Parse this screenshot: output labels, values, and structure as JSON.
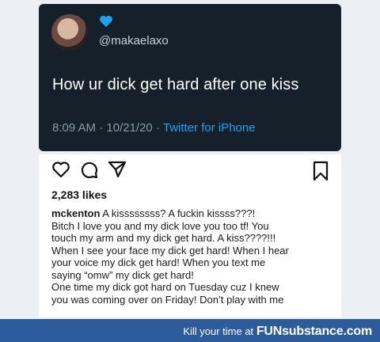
{
  "tweet": {
    "handle": "@makaelaxo",
    "text": "How ur dick get hard after one kiss",
    "time": "8:09 AM",
    "date": "10/21/20",
    "source": "Twitter for iPhone",
    "heart_color": "#1da1f2"
  },
  "post": {
    "likes": "2,283 likes",
    "username": "mckenton",
    "caption_lines": [
      " A kissssssss? A fuckin kissss???!",
      "Bitch I love you and my dick love you too tf! You",
      "touch my arm and my dick get hard. A kiss????!!!",
      "When I see your face my dick get hard! When I hear",
      "your voice my dick get hard! When you text me",
      "saying “omw” my dick get hard!",
      "One time my dick got hard on Tuesday cuz I knew",
      "you was coming over on Friday! Don’t play with me"
    ],
    "icons": [
      "heart-icon",
      "comment-icon",
      "share-icon",
      "bookmark-icon"
    ]
  },
  "footer": {
    "tagline": "Kill your time at",
    "brand_fun": "FUN",
    "brand_rest": "substance.com"
  }
}
